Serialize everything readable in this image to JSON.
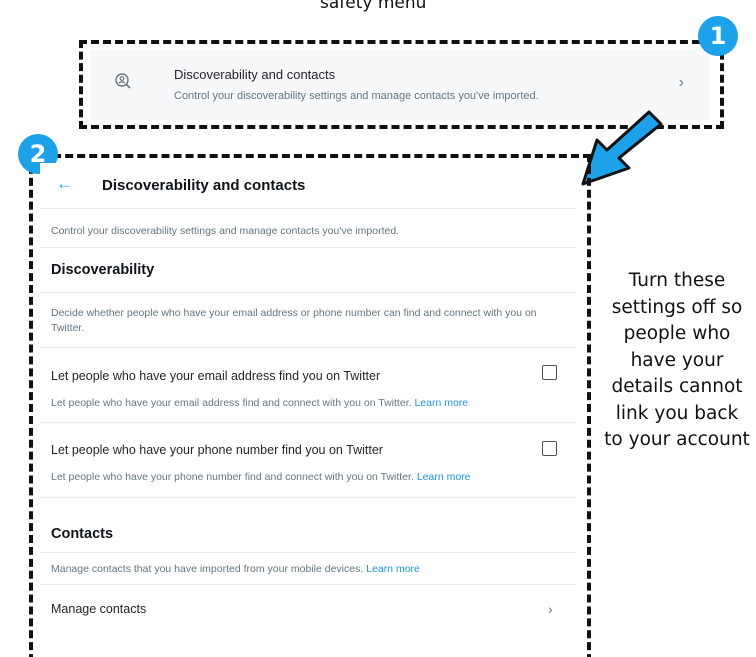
{
  "caption": "safety  menu",
  "menu_item": {
    "icon": "magnifier-person-icon",
    "title": "Discoverability and contacts",
    "subtitle": "Control your discoverability settings and manage contacts you've imported.",
    "chevron": "›"
  },
  "badges": {
    "one": "1",
    "two": "2"
  },
  "panel": {
    "back": "←",
    "title": "Discoverability and contacts",
    "description": "Control your discoverability settings and manage contacts you've imported.",
    "discoverability": {
      "heading": "Discoverability",
      "description": "Decide whether people who have your email address or phone number can find and connect with you on Twitter.",
      "email_setting": {
        "label": "Let people who have your email address find you on Twitter",
        "description": "Let people who have your email address find and connect with you on Twitter.",
        "learn_more": "Learn more",
        "checked": false
      },
      "phone_setting": {
        "label": "Let people who have your phone number find you on Twitter",
        "description": "Let people who have your phone number find and connect with you on Twitter.",
        "learn_more": "Learn more",
        "checked": false
      }
    },
    "contacts": {
      "heading": "Contacts",
      "description": "Manage contacts that you have imported from your mobile devices.",
      "learn_more": "Learn more",
      "manage_label": "Manage contacts",
      "chevron": "›"
    }
  },
  "side_note": "Turn these settings off so people who have your details cannot link you back to your account",
  "colors": {
    "accent": "#1da1e8",
    "link": "#1b95e0",
    "muted": "#66757f"
  }
}
